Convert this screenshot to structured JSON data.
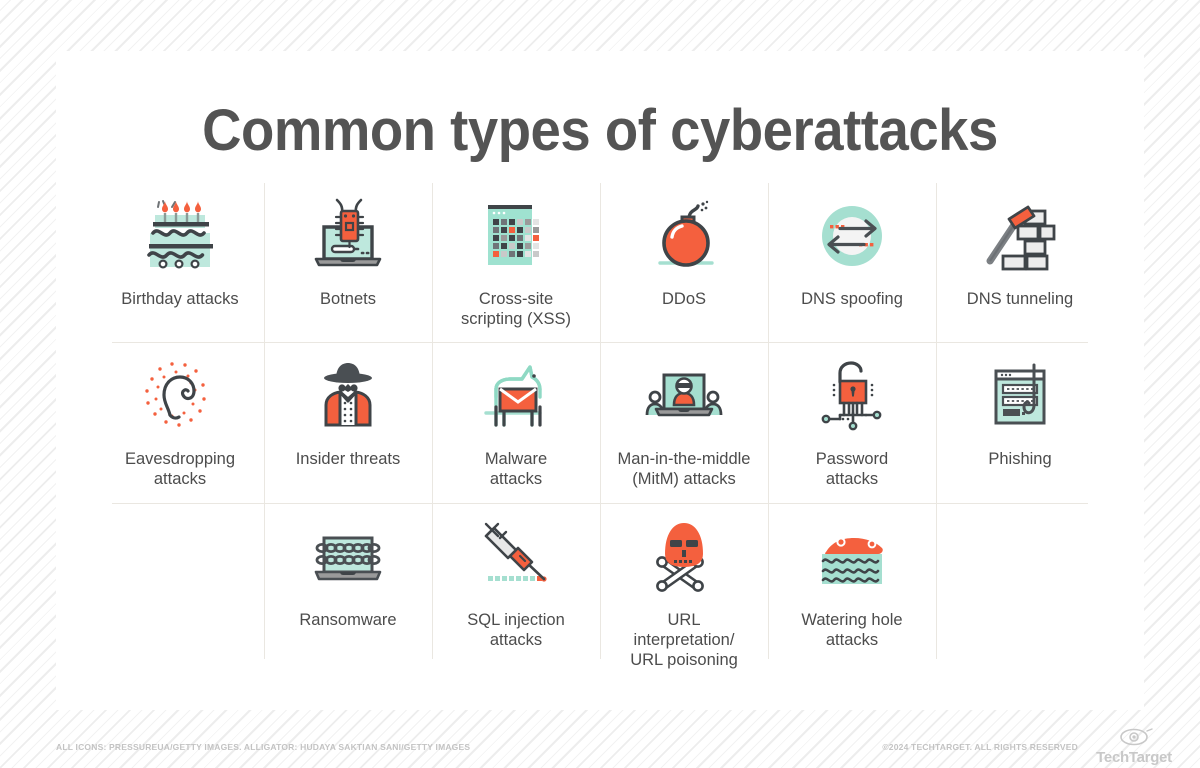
{
  "title": "Common types of cyberattacks",
  "colors": {
    "orange": "#F4603E",
    "teal": "#A5DFD0",
    "dark_gray": "#4C4C4C",
    "title_gray": "#545454",
    "divider": "#EAE7E1"
  },
  "grid": {
    "columns": 6,
    "rows": 3,
    "cells": [
      {
        "label": "Birthday attacks",
        "icon": "birthday-cake-icon"
      },
      {
        "label": "Botnets",
        "icon": "laptop-bug-icon"
      },
      {
        "label": "Cross-site\nscripting (XSS)",
        "icon": "pixel-grid-icon"
      },
      {
        "label": "DDoS",
        "icon": "bomb-icon"
      },
      {
        "label": "DNS spoofing",
        "icon": "two-way-arrows-icon"
      },
      {
        "label": "DNS tunneling",
        "icon": "hammer-bricks-icon"
      },
      {
        "label": "Eavesdropping\nattacks",
        "icon": "ear-icon"
      },
      {
        "label": "Insider threats",
        "icon": "spy-icon"
      },
      {
        "label": "Malware\nattacks",
        "icon": "trojan-horse-icon"
      },
      {
        "label": "Man-in-the-middle\n(MitM) attacks",
        "icon": "laptop-intruder-icon"
      },
      {
        "label": "Password\nattacks",
        "icon": "padlock-circuit-icon"
      },
      {
        "label": "Phishing",
        "icon": "login-hook-icon"
      },
      {
        "label": "",
        "icon": "none"
      },
      {
        "label": "Ransomware",
        "icon": "chained-laptop-icon"
      },
      {
        "label": "SQL injection\nattacks",
        "icon": "syringe-icon"
      },
      {
        "label": "URL\ninterpretation/\nURL poisoning",
        "icon": "skull-crossbones-icon"
      },
      {
        "label": "Watering hole\nattacks",
        "icon": "alligator-water-icon"
      },
      {
        "label": "",
        "icon": "none"
      }
    ]
  },
  "footer": {
    "credits": "ALL ICONS: PRESSUREUA/GETTY IMAGES. ALLIGATOR: HUDAYA SAKTIAN SANI/GETTY IMAGES",
    "copyright": "©2024 TECHTARGET. ALL RIGHTS RESERVED",
    "logo_text": "TechTarget",
    "logo_icon": "eye-icon"
  }
}
